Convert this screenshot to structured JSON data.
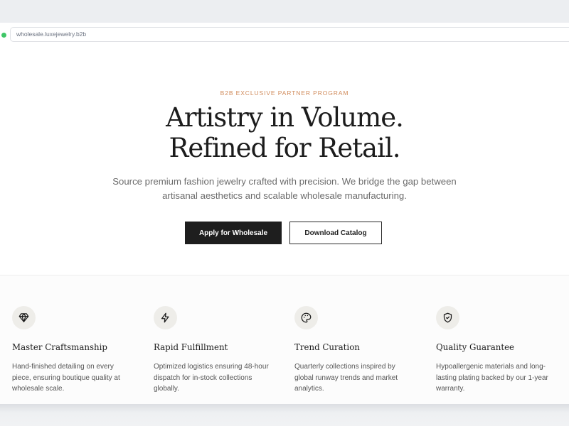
{
  "browser": {
    "url": "wholesale.luxejewelry.b2b"
  },
  "hero": {
    "eyebrow": "B2B EXCLUSIVE PARTNER PROGRAM",
    "headline_line1": "Artistry in Volume.",
    "headline_line2": "Refined for Retail.",
    "subtext_line1": "Source premium fashion jewelry crafted with precision. We bridge the gap between",
    "subtext_line2": "artisanal aesthetics and scalable wholesale manufacturing.",
    "primary_cta": "Apply for Wholesale",
    "secondary_cta": "Download Catalog"
  },
  "features": [
    {
      "icon": "diamond-icon",
      "title": "Master Craftsmanship",
      "desc_lines": [
        "Hand-finished detailing on every",
        "piece, ensuring boutique quality at",
        "wholesale scale."
      ]
    },
    {
      "icon": "lightning-icon",
      "title": "Rapid Fulfillment",
      "desc_lines": [
        "Optimized logistics ensuring 48-hour",
        "dispatch for in-stock collections",
        "globally."
      ]
    },
    {
      "icon": "palette-icon",
      "title": "Trend Curation",
      "desc_lines": [
        "Quarterly collections inspired by",
        "global runway trends and market",
        "analytics."
      ]
    },
    {
      "icon": "shield-check-icon",
      "title": "Quality Guarantee",
      "desc_lines": [
        "Hypoallergenic materials and long-",
        "lasting plating backed by our 1-year",
        "warranty."
      ]
    }
  ],
  "colors": {
    "accent": "#d08a5a",
    "primary_button": "#1e1e1e",
    "status_dot": "#3fc667"
  }
}
